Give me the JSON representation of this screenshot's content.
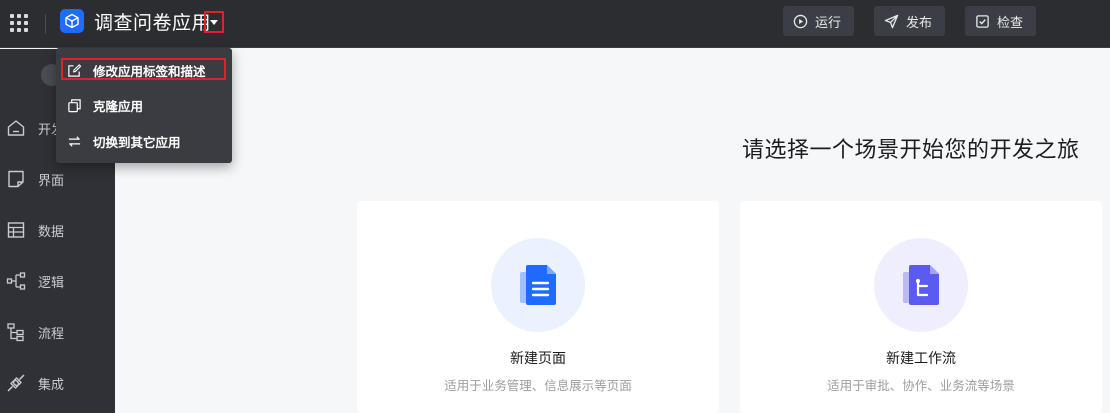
{
  "header": {
    "app_title": "调查问卷应用",
    "actions": [
      {
        "label": "运行",
        "icon": "play-circle-icon"
      },
      {
        "label": "发布",
        "icon": "send-icon"
      },
      {
        "label": "检查",
        "icon": "check-square-icon"
      }
    ]
  },
  "app_menu": {
    "items": [
      {
        "label": "修改应用标签和描述",
        "icon": "edit-icon"
      },
      {
        "label": "克隆应用",
        "icon": "copy-icon"
      },
      {
        "label": "切换到其它应用",
        "icon": "switch-icon"
      }
    ]
  },
  "sidebar": {
    "items": [
      {
        "label": "开发",
        "icon": "home-icon"
      },
      {
        "label": "界面",
        "icon": "page-icon"
      },
      {
        "label": "数据",
        "icon": "table-icon"
      },
      {
        "label": "逻辑",
        "icon": "logic-icon"
      },
      {
        "label": "流程",
        "icon": "flow-icon"
      },
      {
        "label": "集成",
        "icon": "plug-icon"
      }
    ]
  },
  "main": {
    "title": "请选择一个场景开始您的开发之旅",
    "cards": [
      {
        "title": "新建页面",
        "desc": "适用于业务管理、信息展示等页面",
        "icon": "document-icon"
      },
      {
        "title": "新建工作流",
        "desc": "适用于审批、协作、业务流等场景",
        "icon": "workflow-icon"
      }
    ]
  },
  "colors": {
    "topbar_bg": "#2b2d31",
    "accent_blue": "#1f6bff",
    "workflow_purple": "#5b5bf0",
    "highlight_red": "#e0202a"
  }
}
